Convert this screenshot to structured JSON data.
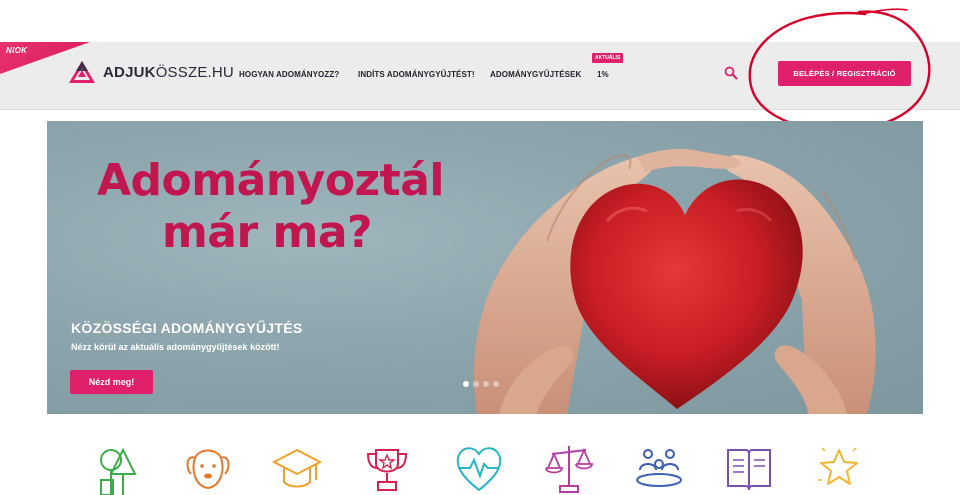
{
  "corner_ribbon": "NIOK",
  "logo": {
    "bold": "ADJUK",
    "rest": "ÖSSZE.HU"
  },
  "nav": {
    "items": [
      {
        "label": "HOGYAN ADOMÁNYOZZ?"
      },
      {
        "label": "INDÍTS ADOMÁNYGYŰJTÉST!"
      },
      {
        "label": "ADOMÁNYGYŰJTÉSEK"
      },
      {
        "label": "1%"
      }
    ],
    "badge": "AKTUÁLIS"
  },
  "login_button": "BELÉPÉS / REGISZTRÁCIÓ",
  "hero": {
    "title_line1": "Adományoztál",
    "title_line2": "már ma?",
    "subtitle": "KÖZÖSSÉGI ADOMÁNYGYŰJTÉS",
    "description": "Nézz körül az aktuális adománygyűjtések között!",
    "button": "Nézd meg!",
    "slides": 4,
    "active_slide": 1
  },
  "categories": [
    {
      "icon": "trees-icon"
    },
    {
      "icon": "dog-icon"
    },
    {
      "icon": "graduation-cap-icon"
    },
    {
      "icon": "trophy-icon"
    },
    {
      "icon": "heartbeat-icon"
    },
    {
      "icon": "scales-icon"
    },
    {
      "icon": "community-icon"
    },
    {
      "icon": "book-icon"
    },
    {
      "icon": "star-icon"
    }
  ],
  "colors": {
    "accent": "#e0206a",
    "hero_title": "#c2164f",
    "annotation": "#d4002a"
  }
}
